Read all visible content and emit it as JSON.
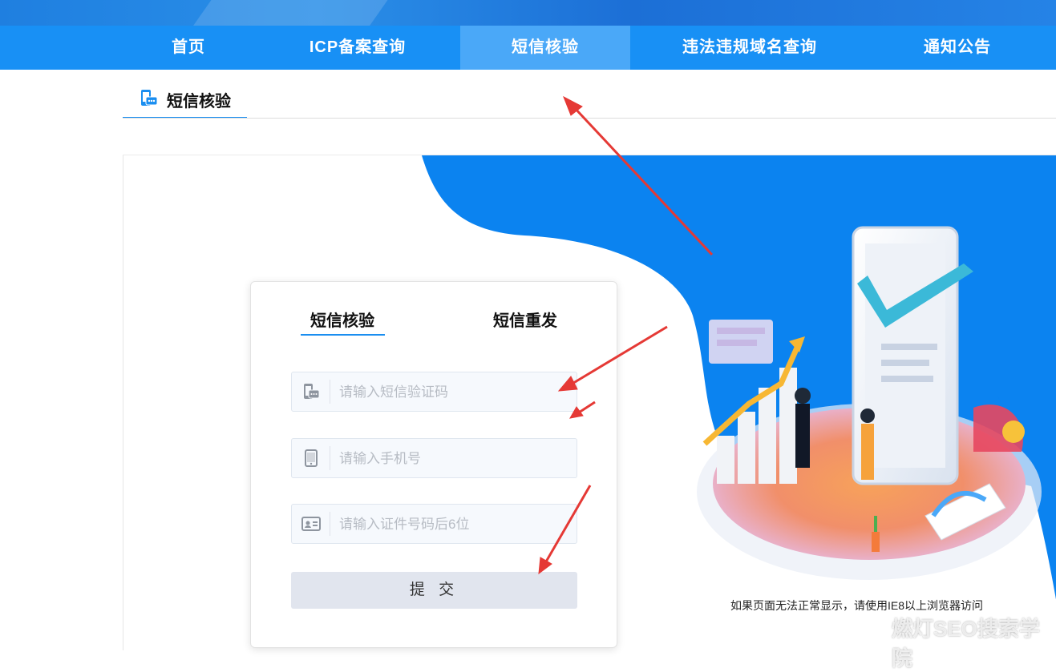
{
  "nav": {
    "items": [
      {
        "label": "首页"
      },
      {
        "label": "ICP备案查询"
      },
      {
        "label": "短信核验"
      },
      {
        "label": "违法违规域名查询"
      },
      {
        "label": "通知公告"
      }
    ],
    "active_index": 2
  },
  "section": {
    "title": "短信核验",
    "icon": "sms-phone-icon"
  },
  "card": {
    "tabs": [
      {
        "label": "短信核验",
        "active": true
      },
      {
        "label": "短信重发",
        "active": false
      }
    ],
    "fields": [
      {
        "icon": "sms-message-icon",
        "placeholder": "请输入短信验证码",
        "value": ""
      },
      {
        "icon": "mobile-phone-icon",
        "placeholder": "请输入手机号",
        "value": ""
      },
      {
        "icon": "id-card-icon",
        "placeholder": "请输入证件号码后6位",
        "value": ""
      }
    ],
    "submit_label": "提 交"
  },
  "notice": "如果页面无法正常显示，请使用IE8以上浏览器访问",
  "watermark": "燃灯SEO搜索学院",
  "colors": {
    "nav_bg": "#1890f5",
    "nav_active": "#4aa8f8",
    "accent": "#1a8ef0",
    "annotation_arrow": "#e53935",
    "button_bg": "#e1e5ee"
  }
}
